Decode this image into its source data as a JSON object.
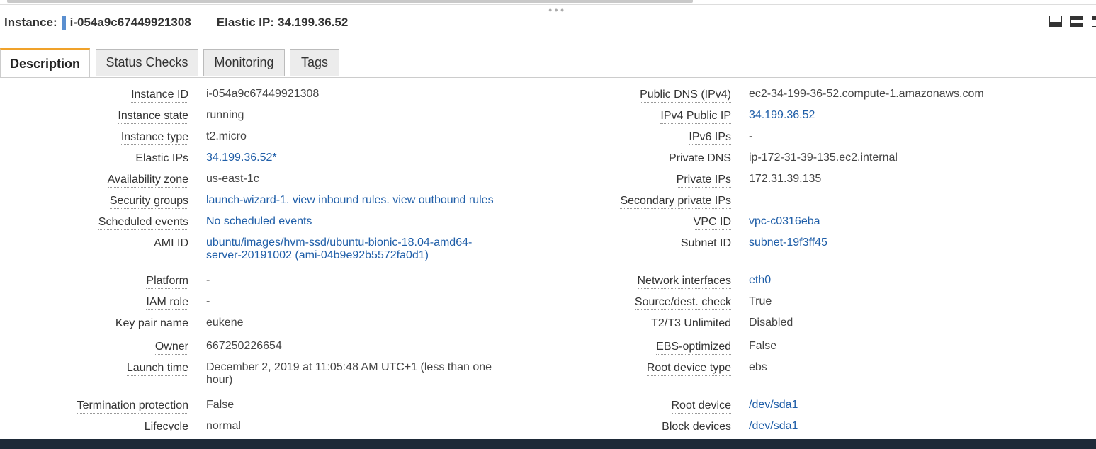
{
  "header": {
    "instance_label": "Instance:",
    "instance_id": "i-054a9c67449921308",
    "eip_label": "Elastic IP:",
    "eip_value": "34.199.36.52",
    "marker_color": "#5a8fd0"
  },
  "tabs": [
    {
      "label": "Description",
      "active": true
    },
    {
      "label": "Status Checks",
      "active": false
    },
    {
      "label": "Monitoring",
      "active": false
    },
    {
      "label": "Tags",
      "active": false
    }
  ],
  "left": [
    {
      "label": "Instance ID",
      "value": "i-054a9c67449921308"
    },
    {
      "label": "Instance state",
      "value": "running"
    },
    {
      "label": "Instance type",
      "value": "t2.micro"
    },
    {
      "label": "Elastic IPs",
      "value": "34.199.36.52*"
    },
    {
      "label": "Availability zone",
      "value": "us-east-1c"
    },
    {
      "label": "Security groups",
      "link1": "launch-wizard-1.",
      "link2": "view inbound rules.",
      "link3": "view outbound rules"
    },
    {
      "label": "Scheduled events",
      "value": "No scheduled events"
    },
    {
      "label": "AMI ID",
      "value": "ubuntu/images/hvm-ssd/ubuntu-bionic-18.04-amd64-server-20191002 (ami-04b9e92b5572fa0d1)"
    },
    {
      "label": "Platform",
      "value": "-"
    },
    {
      "label": "IAM role",
      "value": "-"
    },
    {
      "label": "Key pair name",
      "value": "eukene"
    },
    {
      "label": "Owner",
      "value": "667250226654"
    },
    {
      "label": "Launch time",
      "value": "December 2, 2019 at 11:05:48 AM UTC+1 (less than one hour)"
    },
    {
      "label": "Termination protection",
      "value": "False"
    },
    {
      "label": "Lifecycle",
      "value": "normal"
    }
  ],
  "right": [
    {
      "label": "Public DNS (IPv4)",
      "value": "ec2-34-199-36-52.compute-1.amazonaws.com"
    },
    {
      "label": "IPv4 Public IP",
      "value": "34.199.36.52"
    },
    {
      "label": "IPv6 IPs",
      "value": "-"
    },
    {
      "label": "Private DNS",
      "value": "ip-172-31-39-135.ec2.internal"
    },
    {
      "label": "Private IPs",
      "value": "172.31.39.135"
    },
    {
      "label": "Secondary private IPs",
      "value": ""
    },
    {
      "label": "VPC ID",
      "value": "vpc-c0316eba"
    },
    {
      "label": "Subnet ID",
      "value": "subnet-19f3ff45"
    },
    {
      "label": "Network interfaces",
      "value": "eth0"
    },
    {
      "label": "Source/dest. check",
      "value": "True"
    },
    {
      "label": "T2/T3 Unlimited",
      "value": "Disabled"
    },
    {
      "label": "EBS-optimized",
      "value": "False"
    },
    {
      "label": "Root device type",
      "value": "ebs"
    },
    {
      "label": "Root device",
      "value": "/dev/sda1"
    },
    {
      "label": "Block devices",
      "value": "/dev/sda1"
    }
  ],
  "colors": {
    "link": "#1f5ea8",
    "active_tab_accent": "#f0a22a",
    "status_bar": "#1e2a38"
  }
}
